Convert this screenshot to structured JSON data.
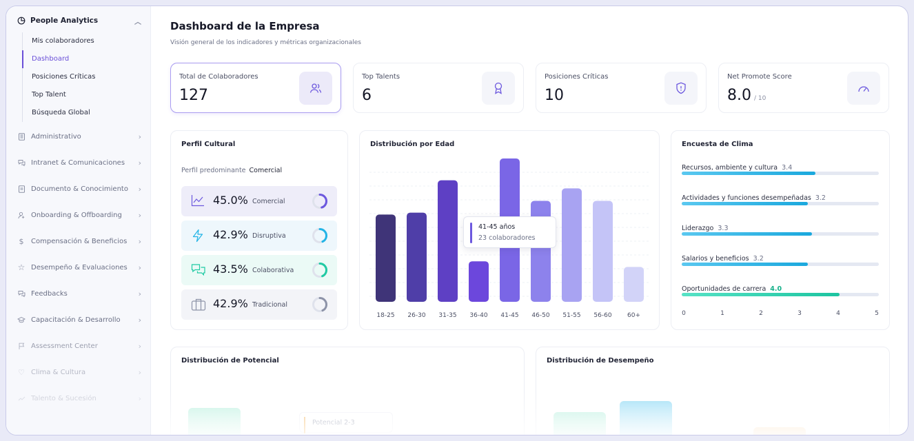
{
  "sidebar": {
    "section": "People Analytics",
    "sub_items": [
      {
        "label": "Mis colaboradores"
      },
      {
        "label": "Dashboard"
      },
      {
        "label": "Posiciones Críticas"
      },
      {
        "label": "Top Talent"
      },
      {
        "label": "Búsqueda Global"
      }
    ],
    "items": [
      {
        "label": "Administrativo",
        "icon": "building-icon"
      },
      {
        "label": "Intranet & Comunicaciones",
        "icon": "chat-icon"
      },
      {
        "label": "Documento & Conocimiento",
        "icon": "document-icon"
      },
      {
        "label": "Onboarding & Offboarding",
        "icon": "user-plus-icon"
      },
      {
        "label": "Compensación & Beneficios",
        "icon": "dollar-icon"
      },
      {
        "label": "Desempeño & Evaluaciones",
        "icon": "star-icon"
      },
      {
        "label": "Feedbacks",
        "icon": "feedback-icon"
      },
      {
        "label": "Capacitación & Desarrollo",
        "icon": "graduation-icon"
      },
      {
        "label": "Assessment Center",
        "icon": "flag-icon"
      },
      {
        "label": "Clima & Cultura",
        "icon": "heart-icon"
      },
      {
        "label": "Talento & Sucesión",
        "icon": "trend-icon"
      }
    ]
  },
  "header": {
    "title": "Dashboard de la Empresa",
    "subtitle": "Visión general de los indicadores y métricas organizacionales"
  },
  "kpis": [
    {
      "label": "Total de Colaboradores",
      "value": "127",
      "unit": "",
      "icon": "users-icon"
    },
    {
      "label": "Top Talents",
      "value": "6",
      "unit": "",
      "icon": "award-icon"
    },
    {
      "label": "Posiciones Críticas",
      "value": "10",
      "unit": "",
      "icon": "shield-icon"
    },
    {
      "label": "Net Promote Score",
      "value": "8.0",
      "unit": "/ 10",
      "icon": "gauge-icon"
    }
  ],
  "perfil": {
    "title": "Perfil Cultural",
    "pred_label": "Perfil predominante",
    "pred_value": "Comercial",
    "rows": [
      {
        "pct": "45.0%",
        "name": "Comercial",
        "fraction": 0.45,
        "color": "#6c58de",
        "bg": "#eeedf9",
        "icon": "chart-line-icon"
      },
      {
        "pct": "42.9%",
        "name": "Disruptiva",
        "fraction": 0.429,
        "color": "#22b4e6",
        "bg": "#eef7fc",
        "icon": "bolt-icon"
      },
      {
        "pct": "43.5%",
        "name": "Colaborativa",
        "fraction": 0.435,
        "color": "#1fcaa3",
        "bg": "#ebfaf6",
        "icon": "chats-icon"
      },
      {
        "pct": "42.9%",
        "name": "Tradicional",
        "fraction": 0.429,
        "color": "#8d93a8",
        "bg": "#f3f4f8",
        "icon": "briefcase-icon"
      }
    ]
  },
  "edad": {
    "title": "Distribución por Edad",
    "tooltip": {
      "range": "41-45 años",
      "count": "23 colaboradores"
    }
  },
  "chart_data": {
    "type": "bar",
    "title": "Distribución por Edad",
    "categories": [
      "18-25",
      "26-30",
      "31-35",
      "36-40",
      "41-45",
      "46-50",
      "51-55",
      "56-60",
      "60+"
    ],
    "values": [
      14,
      14.3,
      19.5,
      6.5,
      23,
      16.2,
      18.2,
      16.2,
      5.6
    ],
    "colors": [
      "#3f3478",
      "#4f3ea8",
      "#5e40c4",
      "#6c47dc",
      "#7a66e6",
      "#8d82ec",
      "#a8a3f2",
      "#c4c4f7",
      "#d2d3f8"
    ],
    "ylim": [
      0,
      23
    ],
    "grid": true,
    "tooltip_category": "41-45"
  },
  "clima": {
    "title": "Encuesta de Clima",
    "rows": [
      {
        "label": "Recursos, ambiente y cultura",
        "value": "3.4",
        "fraction": 0.68,
        "highlight": false
      },
      {
        "label": "Actividades y funciones desempeñadas",
        "value": "3.2",
        "fraction": 0.64,
        "highlight": false
      },
      {
        "label": "Liderazgo",
        "value": "3.3",
        "fraction": 0.66,
        "highlight": false
      },
      {
        "label": "Salarios y beneficios",
        "value": "3.2",
        "fraction": 0.64,
        "highlight": false
      },
      {
        "label": "Oportunidades de carrera",
        "value": "4.0",
        "fraction": 0.8,
        "highlight": true
      }
    ],
    "ticks": [
      "0",
      "1",
      "2",
      "3",
      "4",
      "5"
    ]
  },
  "potencial": {
    "title": "Distribución de Potencial",
    "tag": "Potencial 2-3"
  },
  "desempeno": {
    "title": "Distribución de Desempeño"
  }
}
